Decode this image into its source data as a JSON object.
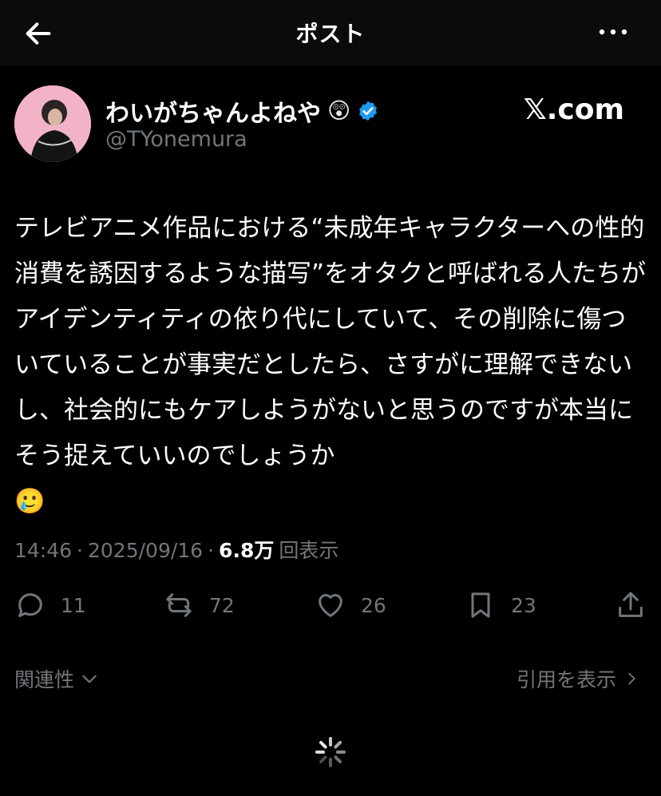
{
  "header": {
    "title": "ポスト",
    "back_icon": "arrow-left-icon",
    "more_icon": "more-horizontal-icon"
  },
  "author": {
    "display_name": "わいがちゃんよねや",
    "name_emoji": "😲",
    "verified_icon": "verified-badge-icon",
    "handle": "@TYonemura",
    "watermark": "𝕏.com"
  },
  "post": {
    "text": "テレビアニメ作品における“未成年キャラクターへの性的消費を誘因するような描写”をオタクと呼ばれる人たちがアイデンティティの依り代にしていて、その削除に傷ついていることが事実だとしたら、さすがに理解できないし、社会的にもケアしようがないと思うのですが本当にそう捉えていいのでしょうか",
    "emoji": "🥲"
  },
  "meta": {
    "time": "14:46",
    "sep1": "·",
    "date": "2025/09/16",
    "sep2": "·",
    "views_count": "6.8万",
    "views_label": "回表示"
  },
  "actions": {
    "reply": {
      "icon": "reply-icon",
      "count": "11"
    },
    "repost": {
      "icon": "repost-icon",
      "count": "72"
    },
    "like": {
      "icon": "heart-icon",
      "count": "26"
    },
    "bookmark": {
      "icon": "bookmark-icon",
      "count": "23"
    },
    "share": {
      "icon": "share-icon"
    }
  },
  "footer": {
    "relevance_label": "関連性",
    "quotes_label": "引用を表示"
  },
  "colors": {
    "background": "#000000",
    "text": "#ffffff",
    "muted": "#71767b",
    "verified": "#1d9bf0"
  }
}
